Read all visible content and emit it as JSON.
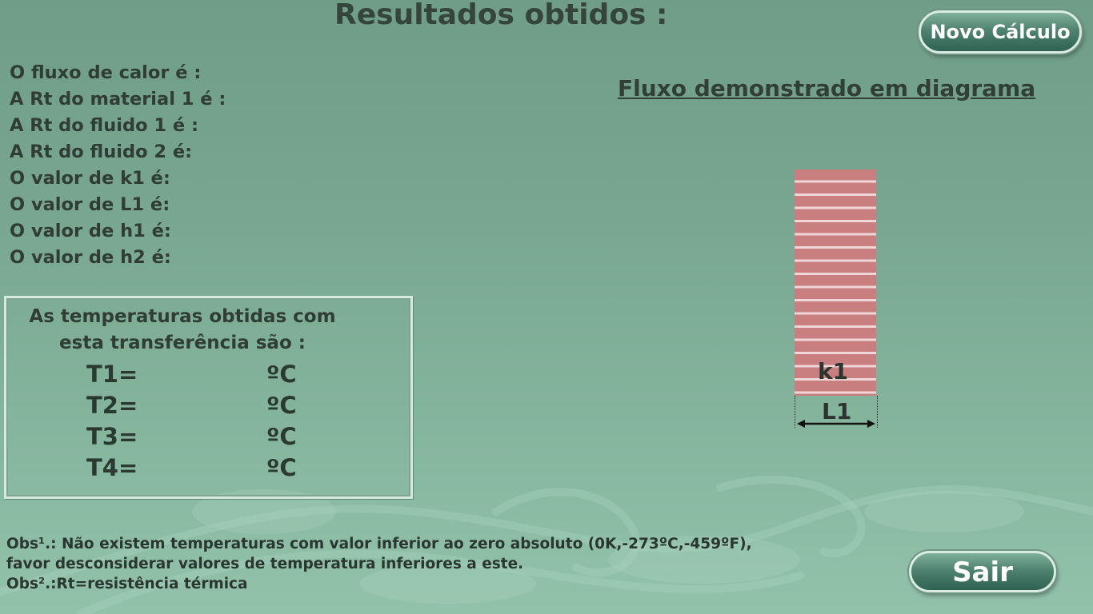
{
  "header": {
    "title": "Resultados obtidos :",
    "new_calc_label": "Novo Cálculo"
  },
  "results": [
    "O fluxo de calor é :",
    "A Rt do material 1 é :",
    "A Rt do fluido 1 é :",
    "A Rt do fluido 2 é:",
    "O valor de k1 é:",
    "O valor de L1 é:",
    "O valor de h1 é:",
    "O valor de h2 é:"
  ],
  "temperatures": {
    "heading_line1": "As temperaturas obtidas com",
    "heading_line2": "esta transferência são :",
    "rows": [
      {
        "label": "T1=",
        "unit": "ºC"
      },
      {
        "label": "T2=",
        "unit": "ºC"
      },
      {
        "label": "T3=",
        "unit": "ºC"
      },
      {
        "label": "T4=",
        "unit": "ºC"
      }
    ]
  },
  "diagram": {
    "title": "Fluxo demonstrado em diagrama",
    "material_label": "k1",
    "thickness_label": "L1",
    "brick_color": "#c97f80",
    "mortar_color": "#f0d6d6"
  },
  "notes": {
    "obs1_line1": "Obs¹.: Não existem temperaturas com valor inferior ao zero absoluto (0K,-273ºC,-459ºF),",
    "obs1_line2": "favor desconsiderar valores de temperatura inferiores a este.",
    "obs2": "Obs².:Rt=resistência térmica"
  },
  "footer": {
    "exit_label": "Sair"
  },
  "theme": {
    "background": "#7ba893",
    "text": "#2f3d36",
    "button": "#3f7362"
  }
}
